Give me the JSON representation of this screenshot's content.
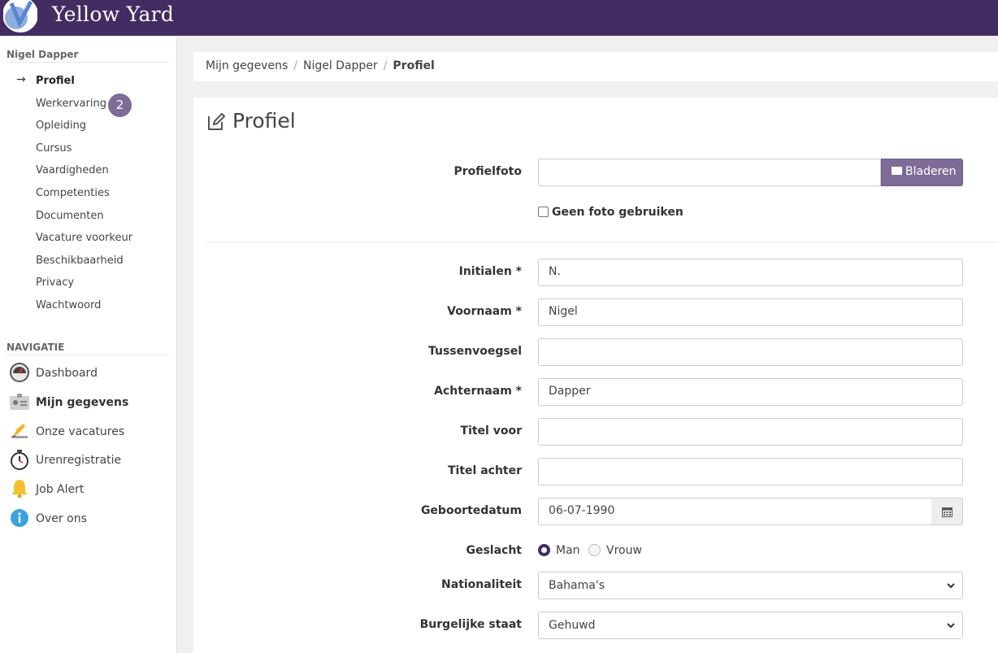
{
  "brand": {
    "name": "Yellow Yard"
  },
  "sidebar": {
    "user_heading": "Nigel Dapper",
    "profile_items": [
      {
        "label": "Profiel",
        "active": true
      },
      {
        "label": "Werkervaring",
        "badge": "2"
      },
      {
        "label": "Opleiding"
      },
      {
        "label": "Cursus"
      },
      {
        "label": "Vaardigheden"
      },
      {
        "label": "Competenties"
      },
      {
        "label": "Documenten"
      },
      {
        "label": "Vacature voorkeur"
      },
      {
        "label": "Beschikbaarheid"
      },
      {
        "label": "Privacy"
      },
      {
        "label": "Wachtwoord"
      }
    ],
    "nav_heading": "NAVIGATIE",
    "nav_items": [
      {
        "label": "Dashboard",
        "icon": "dashboard-gauge-icon"
      },
      {
        "label": "Mijn gegevens",
        "icon": "id-card-icon",
        "active": true
      },
      {
        "label": "Onze vacatures",
        "icon": "pen-icon"
      },
      {
        "label": "Urenregistratie",
        "icon": "stopwatch-icon"
      },
      {
        "label": "Job Alert",
        "icon": "bell-icon"
      },
      {
        "label": "Over ons",
        "icon": "info-icon"
      }
    ]
  },
  "breadcrumb": [
    "Mijn gegevens",
    "Nigel Dapper",
    "Profiel"
  ],
  "page": {
    "title": "Profiel"
  },
  "form": {
    "photo_label": "Profielfoto",
    "browse_label": "Bladeren",
    "no_photo_label": "Geen foto gebruiken",
    "initials": {
      "label": "Initialen *",
      "value": "N."
    },
    "first_name": {
      "label": "Voornaam *",
      "value": "Nigel"
    },
    "infix": {
      "label": "Tussenvoegsel",
      "value": ""
    },
    "last_name": {
      "label": "Achternaam *",
      "value": "Dapper"
    },
    "title_before": {
      "label": "Titel voor",
      "value": ""
    },
    "title_after": {
      "label": "Titel achter",
      "value": ""
    },
    "birth_date": {
      "label": "Geboortedatum",
      "value": "06-07-1990"
    },
    "gender": {
      "label": "Geslacht",
      "option_male": "Man",
      "option_female": "Vrouw",
      "selected": "Man"
    },
    "nationality": {
      "label": "Nationaliteit",
      "value": "Bahama's"
    },
    "marital_status": {
      "label": "Burgelijke staat",
      "value": "Gehuwd"
    }
  },
  "colors": {
    "brand_purple": "#432c62",
    "accent_purple": "#7d6c97"
  }
}
